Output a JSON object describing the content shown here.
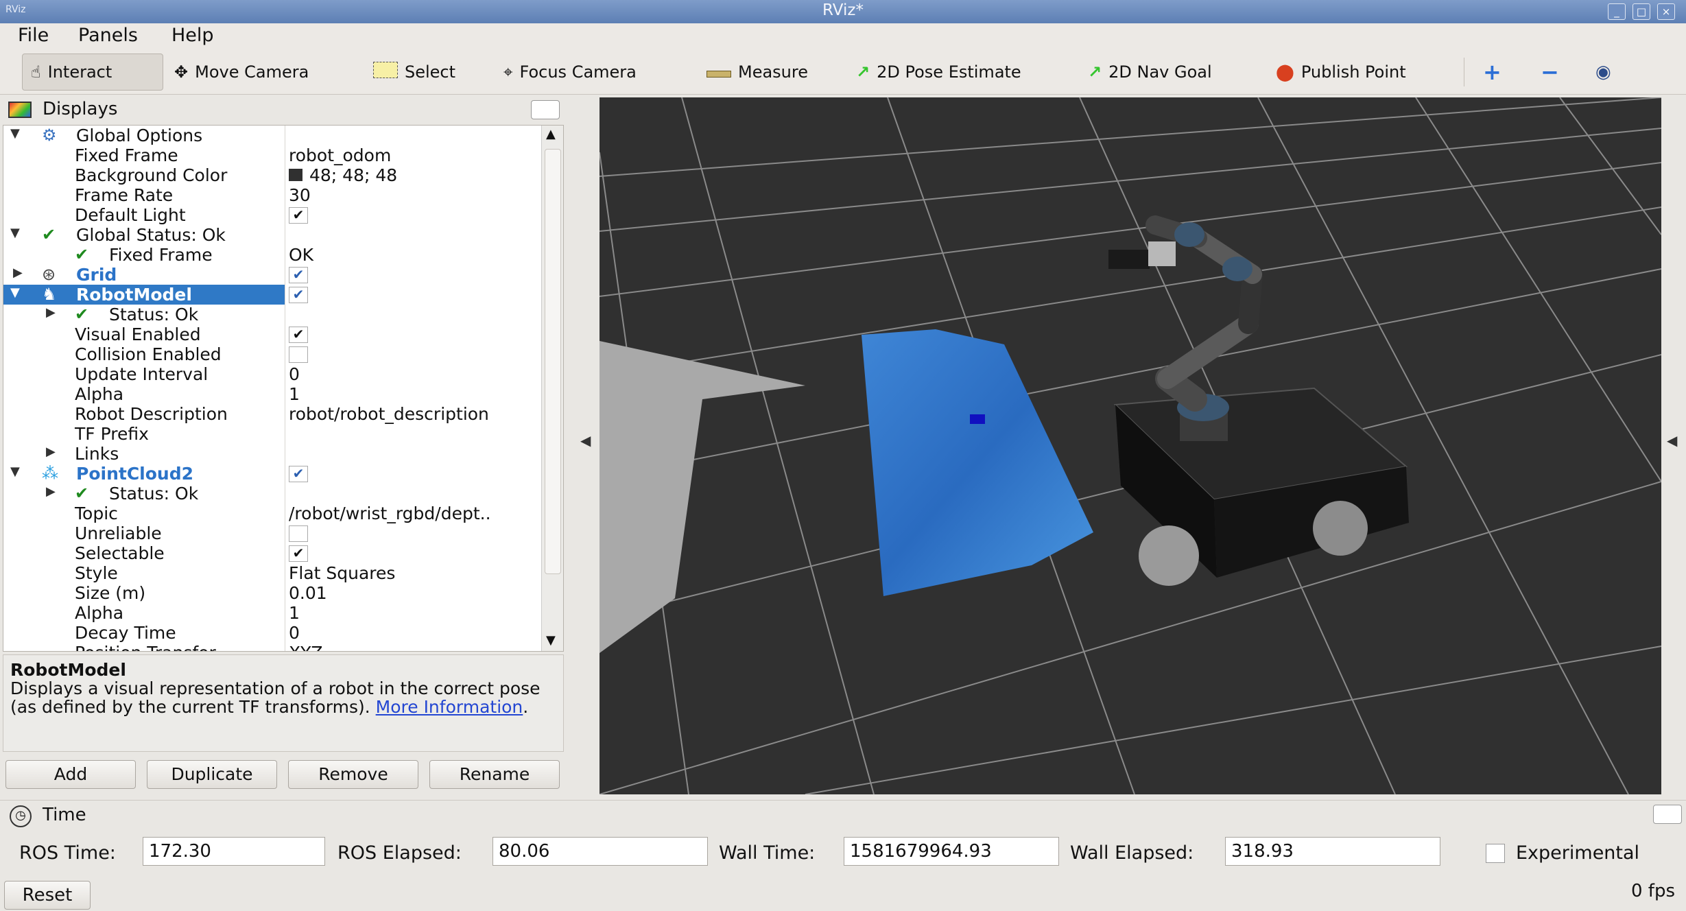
{
  "window": {
    "title": "RViz*",
    "app_icon": "RViz",
    "controls": [
      "_",
      "□",
      "×"
    ]
  },
  "menu": [
    {
      "label": "File"
    },
    {
      "label": "Panels"
    },
    {
      "label": "Help"
    }
  ],
  "toolbar": {
    "tools": [
      {
        "label": "Interact",
        "icon": "hand-icon"
      },
      {
        "label": "Move Camera",
        "icon": "move-camera-icon"
      },
      {
        "label": "Select",
        "icon": "select-icon"
      },
      {
        "label": "Focus Camera",
        "icon": "focus-camera-icon"
      },
      {
        "label": "Measure",
        "icon": "ruler-icon"
      },
      {
        "label": "2D Pose Estimate",
        "icon": "green-arrow-icon"
      },
      {
        "label": "2D Nav Goal",
        "icon": "green-arrow-icon"
      },
      {
        "label": "Publish Point",
        "icon": "map-pin-icon"
      }
    ],
    "extra_icons": [
      "plus-icon",
      "minus-icon",
      "eye-icon"
    ],
    "active_tool": "Interact"
  },
  "displays": {
    "title": "Displays",
    "rows": [
      {
        "name": "Global Options",
        "value": ""
      },
      {
        "name": "Fixed Frame",
        "value": "robot_odom"
      },
      {
        "name": "Background Color",
        "value": "48; 48; 48"
      },
      {
        "name": "Frame Rate",
        "value": "30"
      },
      {
        "name": "Default Light",
        "value": ""
      },
      {
        "name": "Global Status: Ok",
        "value": ""
      },
      {
        "name": "Fixed Frame",
        "value": "OK"
      },
      {
        "name": "Grid",
        "value": ""
      },
      {
        "name": "RobotModel",
        "value": ""
      },
      {
        "name": "Status: Ok",
        "value": ""
      },
      {
        "name": "Visual Enabled",
        "value": ""
      },
      {
        "name": "Collision Enabled",
        "value": ""
      },
      {
        "name": "Update Interval",
        "value": "0"
      },
      {
        "name": "Alpha",
        "value": "1"
      },
      {
        "name": "Robot Description",
        "value": "robot/robot_description"
      },
      {
        "name": "TF Prefix",
        "value": ""
      },
      {
        "name": "Links",
        "value": ""
      },
      {
        "name": "PointCloud2",
        "value": ""
      },
      {
        "name": "Status: Ok",
        "value": ""
      },
      {
        "name": "Topic",
        "value": "/robot/wrist_rgbd/dept.."
      },
      {
        "name": "Unreliable",
        "value": ""
      },
      {
        "name": "Selectable",
        "value": ""
      },
      {
        "name": "Style",
        "value": "Flat Squares"
      },
      {
        "name": "Size (m)",
        "value": "0.01"
      },
      {
        "name": "Alpha",
        "value": "1"
      },
      {
        "name": "Decay Time",
        "value": "0"
      },
      {
        "name": "Position Transfor",
        "value": "XYZ"
      }
    ],
    "checkbox_states": {
      "default_light": true,
      "grid": true,
      "robotmodel": true,
      "visual_enabled": true,
      "collision_enabled": false,
      "pointcloud2": true,
      "unreliable": false,
      "selectable": true
    },
    "description": {
      "heading": "RobotModel",
      "text": "Displays a visual representation of a robot in the correct pose (as defined by the current TF transforms).",
      "link": "More Information",
      "trailing": "."
    },
    "buttons": [
      {
        "label": "Add"
      },
      {
        "label": "Duplicate"
      },
      {
        "label": "Remove"
      },
      {
        "label": "Rename"
      }
    ]
  },
  "time": {
    "title": "Time",
    "ros_time_label": "ROS Time:",
    "ros_time": "172.30",
    "ros_elapsed_label": "ROS Elapsed:",
    "ros_elapsed": "80.06",
    "wall_time_label": "Wall Time:",
    "wall_time": "1581679964.93",
    "wall_elapsed_label": "Wall Elapsed:",
    "wall_elapsed": "318.93",
    "experimental_label": "Experimental",
    "reset_label": "Reset",
    "fps": "0 fps"
  },
  "colors": {
    "background": "#303030",
    "selection": "#2f79c6",
    "grid_line": "#8a8a8a"
  }
}
